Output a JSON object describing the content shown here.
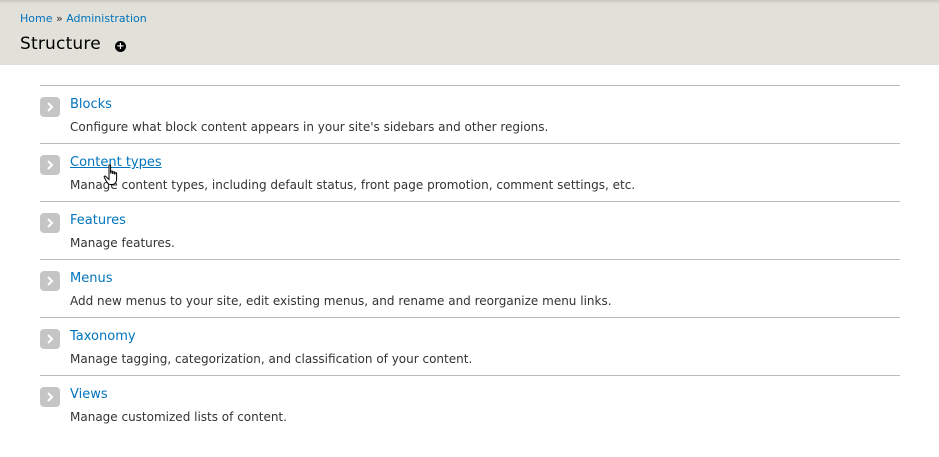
{
  "breadcrumb": {
    "items": [
      "Home",
      "Administration"
    ],
    "separator": "»"
  },
  "page": {
    "title": "Structure",
    "shortcut_glyph": "+"
  },
  "items": [
    {
      "title": "Blocks",
      "description": "Configure what block content appears in your site's sidebars and other regions."
    },
    {
      "title": "Content types",
      "description": "Manage content types, including default status, front page promotion, comment settings, etc."
    },
    {
      "title": "Features",
      "description": "Manage features."
    },
    {
      "title": "Menus",
      "description": "Add new menus to your site, edit existing menus, and rename and reorganize menu links."
    },
    {
      "title": "Taxonomy",
      "description": "Manage tagging, categorization, and classification of your content."
    },
    {
      "title": "Views",
      "description": "Manage customized lists of content."
    }
  ],
  "colors": {
    "link": "#0074bd",
    "header_bg": "#e1e0d9",
    "arrow_bg": "#c5c5c5"
  },
  "icons": {
    "item_arrow": "chevron-right-icon",
    "shortcut": "add-shortcut-icon",
    "cursor": "hand-pointer-icon"
  }
}
